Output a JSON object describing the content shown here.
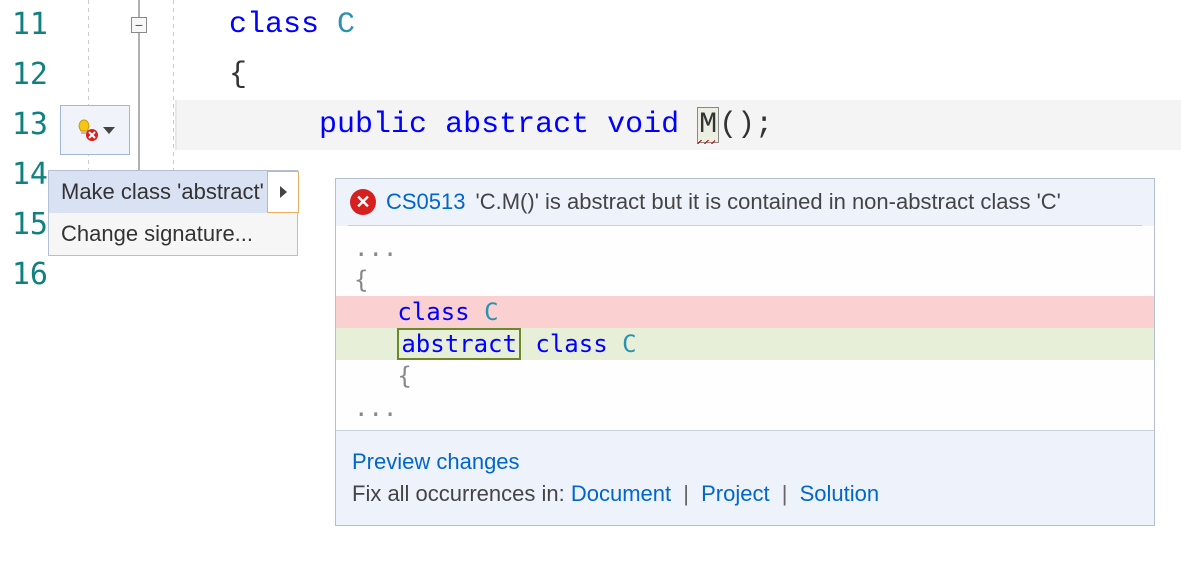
{
  "line_numbers": [
    "11",
    "12",
    "13",
    "14",
    "15",
    "16"
  ],
  "code": {
    "kw_class": "class",
    "class_name": "C",
    "open_brace": "{",
    "kw_public": "public",
    "kw_abstract": "abstract",
    "kw_void": "void",
    "method_name": "M",
    "method_parens": "();"
  },
  "quickfix": {
    "item1": "Make class 'abstract'",
    "item2": "Change signature..."
  },
  "preview": {
    "error_code": "CS0513",
    "error_msg": "'C.M()' is abstract but it is contained in non-abstract class 'C'",
    "ellipsis": "...",
    "brace_open": "{",
    "old_class": "class",
    "old_name": "C",
    "new_abstract": "abstract",
    "new_class": "class",
    "new_name": "C",
    "brace_open2": "{",
    "footer_preview": "Preview changes",
    "footer_fixall": "Fix all occurrences in:",
    "scope_doc": "Document",
    "scope_proj": "Project",
    "scope_sol": "Solution"
  }
}
